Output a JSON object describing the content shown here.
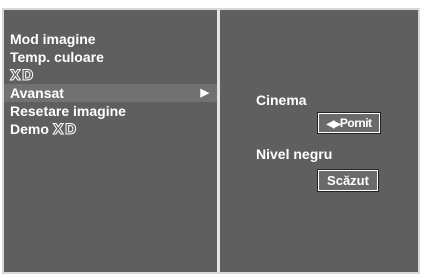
{
  "menu": {
    "items": [
      {
        "label": "Mod imagine"
      },
      {
        "label": "Temp. culoare"
      },
      {
        "logo": "XD"
      },
      {
        "label": "Avansat",
        "arrow": "▶"
      },
      {
        "label": "Resetare imagine"
      },
      {
        "label": "Demo",
        "logo": "XD"
      }
    ]
  },
  "settings": {
    "cinema": {
      "label": "Cinema",
      "arrows": "◀▶",
      "value": "Pornit"
    },
    "nivel_negru": {
      "label": "Nivel negru",
      "value": "Scăzut"
    }
  },
  "colors": {
    "panel_bg": "#5f5f5f",
    "selected_bg": "#717171",
    "text": "#ffffff",
    "divider": "#e4e4e4"
  }
}
